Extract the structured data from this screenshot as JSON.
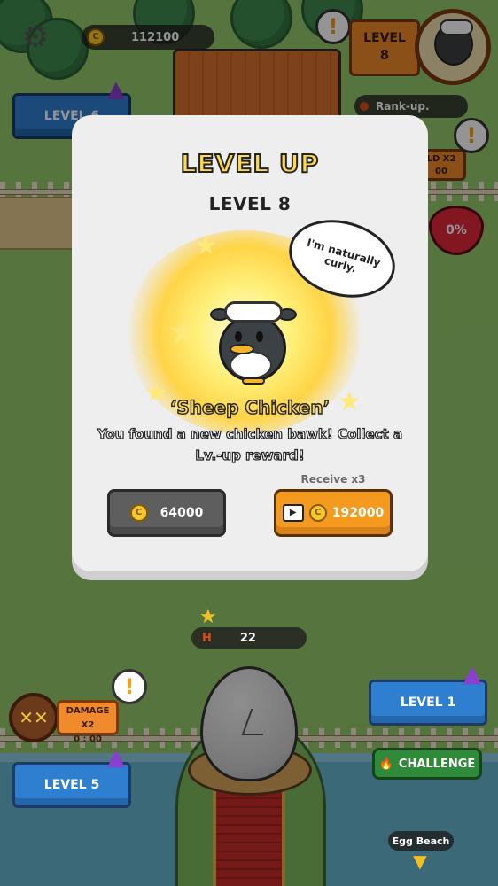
{
  "hud": {
    "coins": "112100",
    "coin_symbol": "C",
    "level_label": "LEVEL",
    "level_value": "8",
    "rank_up": "Rank-up.",
    "gear_icon": "gear-icon"
  },
  "side": {
    "left_level_button": "LEVEL 6",
    "gold_partial_1": "LD X2",
    "gold_partial_2": "00",
    "heart_percent": "0%",
    "damage_label": "DAMAGE X2",
    "damage_timer": "0 : 00",
    "bottom_left_level": "LEVEL 5",
    "right_level": "LEVEL 1",
    "challenge": "CHALLENGE",
    "egg_beach": "Egg Beach",
    "h_label": "H",
    "h_value": "22"
  },
  "modal": {
    "title": "LEVEL UP",
    "subtitle": "LEVEL 8",
    "speech": "I'm naturally curly.",
    "chicken_name": "‘Sheep Chicken’",
    "description": "You found a new chicken bawk! Collect a Lv.-up reward!",
    "receive_label": "Receive x3",
    "claim_amount": "64000",
    "claim3_amount": "192000"
  },
  "colors": {
    "accent_orange": "#f39a1f",
    "title_yellow": "#ffd94a",
    "button_blue": "#2f7fd0"
  }
}
